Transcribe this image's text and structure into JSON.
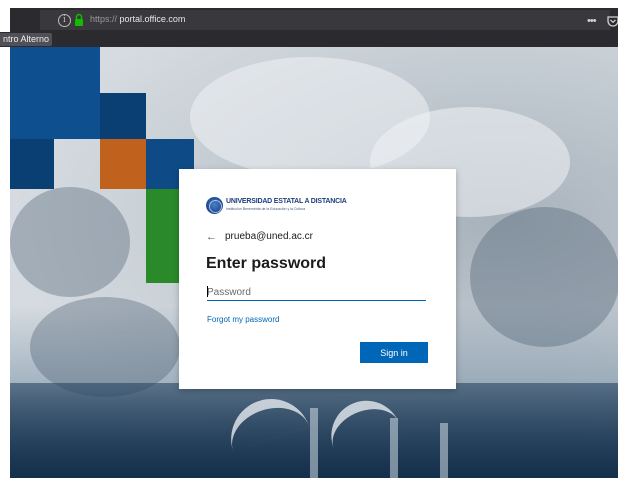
{
  "browser": {
    "url_scheme": "https://",
    "url_host": "portal.office.com",
    "icons": [
      "info-icon",
      "lock-icon",
      "more-actions-icon",
      "pocket-icon",
      "bookmark-star-icon"
    ],
    "bookmark_label": "ntro Alterno"
  },
  "background": {
    "square_colors": [
      "#0d4f8f",
      "#0a3f73",
      "#c0611d",
      "#0e4b86",
      "#2a8a2a"
    ]
  },
  "card": {
    "logo_name": "UNIVERSIDAD ESTATAL A DISTANCIA",
    "logo_subtitle": "Institución Benemérita de la Educación y la Cultura",
    "back_icon": "back-arrow-icon",
    "identity": "prueba@uned.ac.cr",
    "title": "Enter password",
    "password_placeholder": "Password",
    "password_value": "",
    "forgot_link": "Forgot my password",
    "signin_button": "Sign in",
    "accent_color": "#0067b8"
  }
}
